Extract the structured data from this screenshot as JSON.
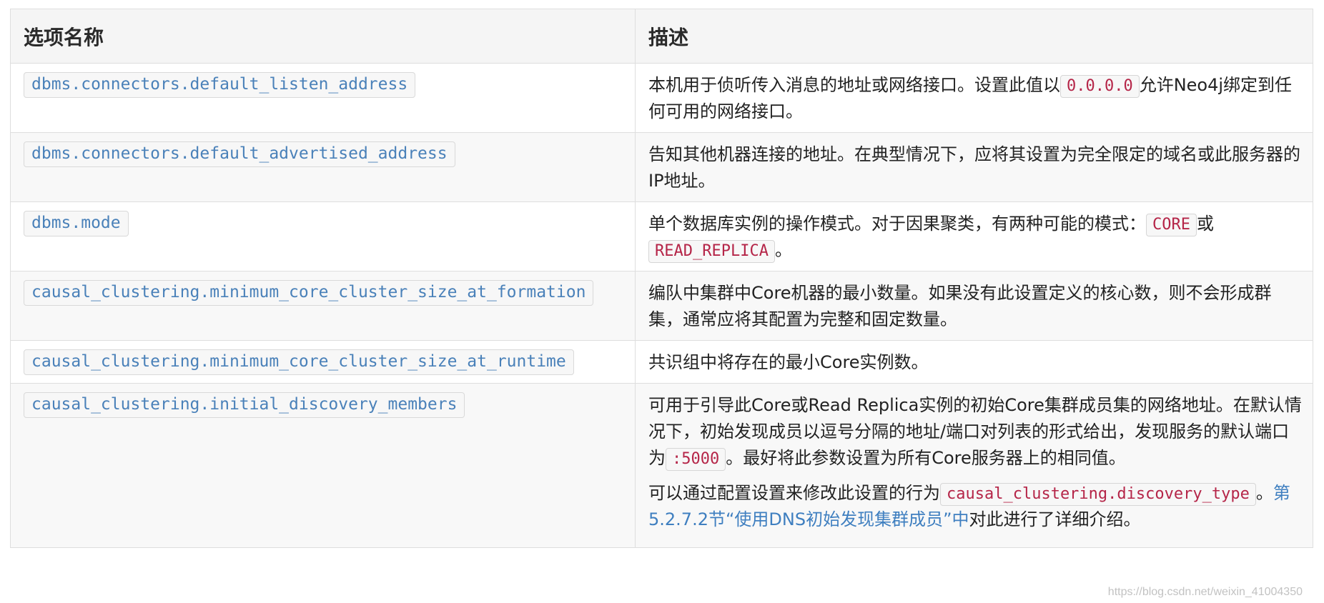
{
  "table": {
    "headers": [
      "选项名称",
      "描述"
    ],
    "rows": [
      {
        "option": "dbms.connectors.default_listen_address",
        "desc": {
          "t1": "本机用于侦听传入消息的地址或网络接口。设置此值以",
          "code1": "0.0.0.0",
          "t2": "允许Neo4j绑定到任何可用的网络接口。"
        }
      },
      {
        "option": "dbms.connectors.default_advertised_address",
        "desc": {
          "t1": "告知其他机器连接的地址。在典型情况下，应将其设置为完全限定的域名或此服务器的IP地址。"
        }
      },
      {
        "option": "dbms.mode",
        "desc": {
          "t1": "单个数据库实例的操作模式。对于因果聚类，有两种可能的模式：",
          "code1": "CORE",
          "t2": "或",
          "code2": "READ_REPLICA",
          "t3": "。"
        }
      },
      {
        "option": "causal_clustering.minimum_core_cluster_size_at_formation",
        "desc": {
          "t1": "编队中集群中Core机器的最小数量。如果没有此设置定义的核心数，则不会形成群集，通常应将其配置为完整和固定数量。"
        }
      },
      {
        "option": "causal_clustering.minimum_core_cluster_size_at_runtime",
        "desc": {
          "t1": "共识组中将存在的最小Core实例数。"
        }
      },
      {
        "option": "causal_clustering.initial_discovery_members",
        "desc": {
          "t1": "可用于引导此Core或Read Replica实例的初始Core集群成员集的网络地址。在默认情况下，初始发现成员以逗号分隔的地址/端口对列表的形式给出，发现服务的默认端口为",
          "code1": ":5000",
          "t2": "。最好将此参数设置为所有Core服务器上的相同值。",
          "p2_t1": "可以通过配置设置来修改此设置的行为",
          "p2_code": "causal_clustering.discovery_type",
          "p2_t2": "。",
          "p2_link": "第5.2.7.2节“使用DNS初始发现集群成员”中",
          "p2_t3": "对此进行了详细介绍。"
        }
      }
    ]
  },
  "watermark": "https://blog.csdn.net/weixin_41004350",
  "colors": {
    "option_text": "#4a81b9",
    "value_text": "#b52548",
    "link": "#3f7fc0",
    "header_bg": "#f5f5f5",
    "alt_row_bg": "#f8f8f8"
  }
}
